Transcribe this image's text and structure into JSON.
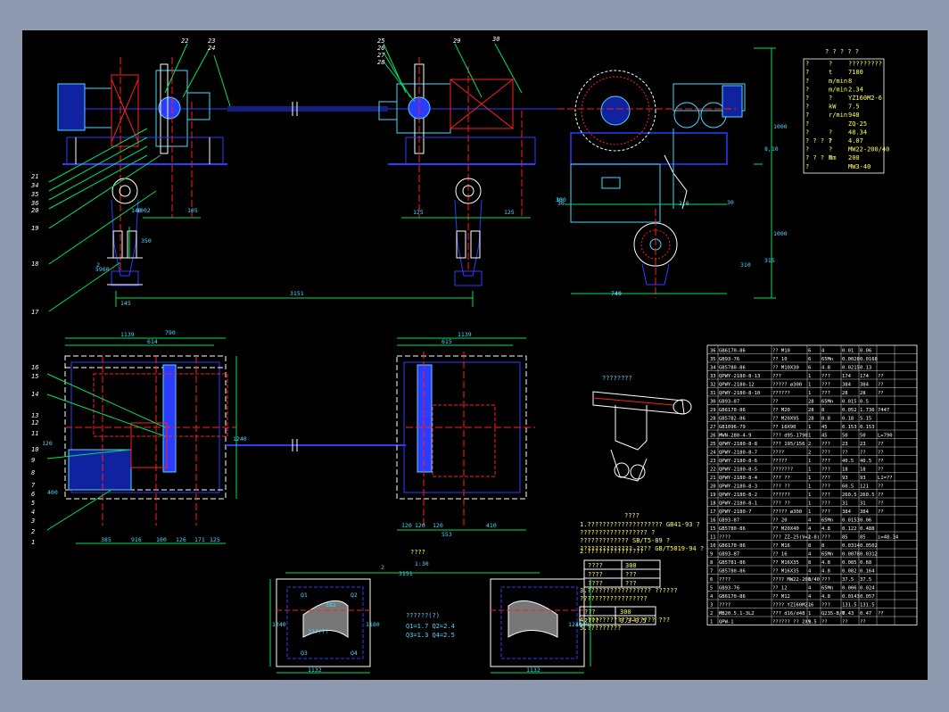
{
  "window": {
    "background": "#8e9aaf",
    "canvas": "#000000"
  },
  "colors": {
    "cyan": "#4cd8ff",
    "blue": "#2b3cff",
    "red": "#ff2020",
    "yellow": "#ffff40",
    "green": "#00e060",
    "white": "#ffffff",
    "magenta": "#ff40ff"
  },
  "callouts": [
    "22",
    "23",
    "24",
    "25",
    "26",
    "27",
    "28",
    "29",
    "30",
    "21",
    "34",
    "35",
    "36",
    "20",
    "19",
    "18",
    "17",
    "16",
    "15",
    "14",
    "13",
    "12",
    "11",
    "10",
    "9",
    "8",
    "7",
    "6",
    "5",
    "4",
    "3",
    "2",
    "1"
  ],
  "dims": {
    "front_left": [
      "2",
      "140",
      "1002",
      "105"
    ],
    "front_mid": [
      "350",
      "3151",
      "145",
      "5960"
    ],
    "front_right": [
      "125",
      "125",
      "100",
      "30",
      "740",
      "2,6"
    ],
    "side_right": [
      "1000",
      "8,10",
      "315",
      "1000",
      "30",
      "30",
      "310",
      "740"
    ],
    "plan_left": [
      "1139",
      "790",
      "614",
      "1240",
      "385",
      "916",
      "100",
      "126",
      "171",
      "120",
      "125",
      "400"
    ],
    "plan_right": [
      "1139",
      "615",
      "120",
      "120",
      "120",
      "553",
      "410"
    ],
    "bottom_center": [
      "1:30",
      "3151"
    ],
    "bottom_boxes": [
      "2",
      "1240",
      "1240",
      "382",
      "1132",
      "1132",
      "1180",
      "1180",
      "Q1",
      "Q2",
      "Q3",
      "Q4"
    ]
  },
  "spec_table": {
    "title": "? ? ? ? ?",
    "rows": [
      [
        "?",
        "?",
        "?????????"
      ],
      [
        "?",
        "t",
        "7180"
      ],
      [
        "?",
        "m/min",
        "8"
      ],
      [
        "?",
        "m/min",
        "2.34"
      ],
      [
        "?",
        "?",
        "YZ160M2-6"
      ],
      [
        "?",
        "kW",
        "7.5"
      ],
      [
        "?",
        "r/min",
        "948"
      ],
      [
        "?",
        "",
        "ZQ-25"
      ],
      [
        "?",
        "?",
        "48.34"
      ],
      [
        "? ? ? ?",
        "?",
        "4.07"
      ],
      [
        "?",
        "?",
        "MW22-200/40"
      ],
      [
        "? ? ? ?",
        "Nm",
        "200"
      ],
      [
        "?",
        "",
        "MW3-40"
      ]
    ]
  },
  "bom": {
    "rows": [
      [
        "36",
        "GB6170-86",
        "?? M10",
        "6",
        "4",
        "0.01",
        "0.06",
        ""
      ],
      [
        "35",
        "GB93-76",
        "?? 10",
        "6",
        "65Mn",
        "0.0028",
        "0.0168",
        ""
      ],
      [
        "34",
        "GB5780-86",
        "?? M10X30",
        "6",
        "4.8",
        "0.0215",
        "0.13",
        ""
      ],
      [
        "33",
        "QPWY-2180-8-13",
        "???",
        "1",
        "???",
        "174",
        "174",
        "??"
      ],
      [
        "32",
        "QPWY-2180-12",
        "????? ø300",
        "1",
        "???",
        "384",
        "384",
        "??"
      ],
      [
        "31",
        "QPWY-2180-8-10",
        "??????",
        "1",
        "???",
        "28",
        "28",
        "??"
      ],
      [
        "30",
        "GB93-87",
        "??",
        "28",
        "65Mn",
        "0.015",
        "0.5",
        ""
      ],
      [
        "29",
        "GB6170-86",
        "?? M20",
        "28",
        "8",
        "0.052",
        "1.736",
        "7447"
      ],
      [
        "28",
        "GB5782-86",
        "?? M20X95",
        "28",
        "8.8",
        "0.18",
        "5.15",
        ""
      ],
      [
        "27",
        "GB1096-79",
        "?? 16X90",
        "1",
        "45",
        "0.153",
        "0.153",
        ""
      ],
      [
        "26",
        "MWN-280-4-9",
        "??? d95-1790",
        "1",
        "45",
        "50",
        "50",
        "L=790"
      ],
      [
        "25",
        "QPWY-2180-8-8",
        "??? 195/156",
        "2",
        "???",
        "23",
        "23",
        "??"
      ],
      [
        "24",
        "QPWY-2180-8-7",
        "????",
        "2",
        "???",
        "??",
        "??",
        "??"
      ],
      [
        "23",
        "QPWY-2180-8-6",
        "?????",
        "1",
        "???",
        "40.5",
        "40.5",
        "??"
      ],
      [
        "22",
        "QPWY-2180-8-5",
        "???????",
        "1",
        "???",
        "18",
        "18",
        "??"
      ],
      [
        "21",
        "QPWY-2180-8-4",
        "??? ??",
        "1",
        "???",
        "93",
        "93",
        "L1=??"
      ],
      [
        "20",
        "QPWY-2180-8-3",
        "??? ??",
        "1",
        "???",
        "60.5",
        "121",
        "??"
      ],
      [
        "19",
        "QPWY-2180-8-2",
        "??????",
        "1",
        "???",
        "260.5",
        "260.5",
        "??"
      ],
      [
        "18",
        "QPWY-2180-8-1",
        "??? ??",
        "1",
        "???",
        "31",
        "31",
        "??"
      ],
      [
        "17",
        "QPWY-2180-7",
        "????? ø300",
        "1",
        "???",
        "384",
        "384",
        "??"
      ],
      [
        "16",
        "GB93-87",
        "?? 20",
        "4",
        "65Mn",
        "0.0153",
        "0.06",
        ""
      ],
      [
        "15",
        "GB5780-86",
        "?? M20X40",
        "4",
        "4.8",
        "0.122",
        "0.488",
        ""
      ],
      [
        "11",
        "????",
        "??? ZZ-25(V=2-8)",
        "1",
        "???",
        "85",
        "85",
        "i=48.34"
      ],
      [
        "10",
        "GB6170-86",
        "?? M16",
        "8",
        "8",
        "0.0314",
        "0.0502",
        ""
      ],
      [
        "9",
        "GB93-87",
        "?? 16",
        "4",
        "65Mn",
        "0.0078",
        "0.0312",
        ""
      ],
      [
        "8",
        "GB5781-86",
        "?? M16X35",
        "8",
        "4.8",
        "0.085",
        "0.68",
        ""
      ],
      [
        "7",
        "GB5780-86",
        "?? M16X35",
        "4",
        "4.8",
        "0.082",
        "0.164",
        ""
      ],
      [
        "6",
        "????",
        "???? MW22-200/40",
        "1",
        "???",
        "37.5",
        "37.5",
        ""
      ],
      [
        "5",
        "GB93-76",
        "?? 12",
        "4",
        "65Mn",
        "0.006",
        "0.024",
        ""
      ],
      [
        "4",
        "GB6170-86",
        "?? M12",
        "4",
        "4.8",
        "0.0143",
        "0.057",
        ""
      ],
      [
        "3",
        "????",
        "???? YZ160M2-6",
        "1",
        "???",
        "131.5",
        "131.5",
        ""
      ],
      [
        "2",
        "MB20.5.1-3L2",
        "??? d16/d48",
        "1",
        "Q235-B/T",
        "0.43",
        "0.47",
        "??"
      ],
      [
        "1",
        "QPW-1",
        "?????? ?? 2X9.5",
        "1",
        "??",
        "??",
        "??",
        ""
      ]
    ]
  },
  "notes": {
    "heading": "????",
    "lines": [
      "1.???????????????????? GB41-93 ?",
      "?????????????????? ?",
      "????????????? SB/T5-89 ?",
      "?????????????? ???? GB/T5019-94 ?",
      "2.???????????????",
      "3.????????????????? ??????",
      "??????????????????",
      "4.?????????????????? ???",
      "5.?????????"
    ],
    "table1": [
      [
        "????",
        "300"
      ],
      [
        "????",
        "???"
      ],
      [
        "????",
        "???"
      ]
    ],
    "table2": [
      [
        "???",
        "300"
      ],
      [
        "????",
        "0.3~0.5"
      ]
    ]
  },
  "bottom": {
    "title": "????",
    "scale": "1:30",
    "label1": "??????(?)",
    "q_values": [
      "Q1=1.7  Q2=2.4",
      "Q3=1.3  Q4=2.5"
    ],
    "hatch_label": "??????"
  },
  "detail_label": "????????"
}
